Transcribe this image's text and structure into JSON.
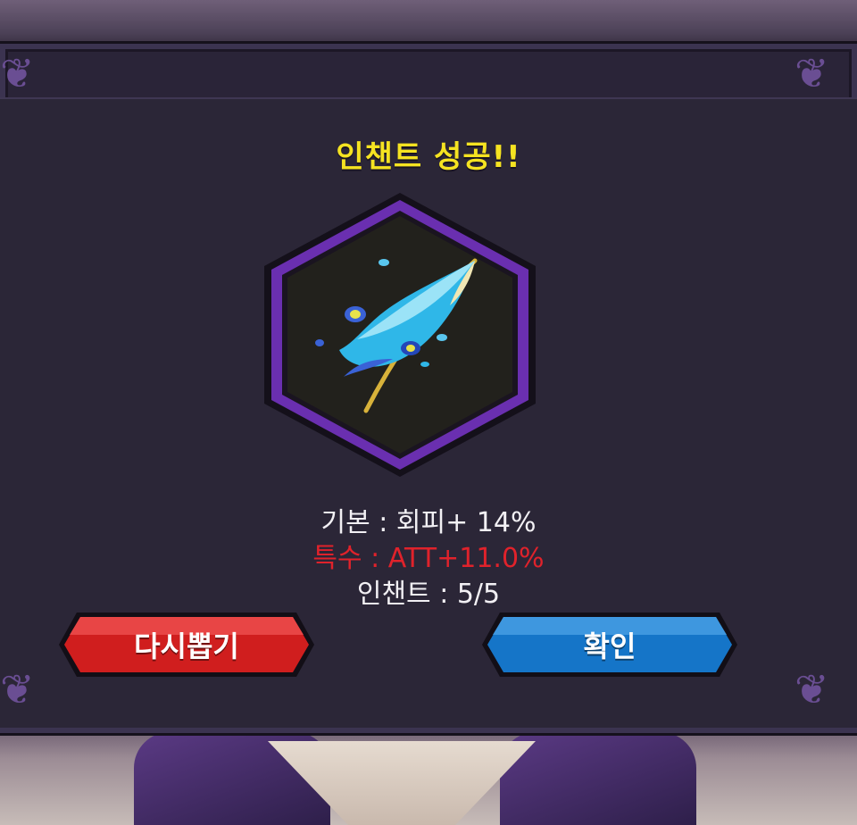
{
  "dialog": {
    "title": "인챈트 성공!!",
    "item": {
      "icon": "peacock-feather-icon",
      "frame_color": "#6a2fb0"
    },
    "stats": {
      "basic": "기본 : 회피+ 14%",
      "special": "특수 : ATT+11.0%",
      "enchant": "인챈트 : 5/5"
    },
    "buttons": {
      "redraw_label": "다시뽑기",
      "confirm_label": "확인"
    }
  },
  "colors": {
    "title": "#f5e321",
    "special_stat": "#e0222b",
    "redraw_button": "#d01e1e",
    "confirm_button": "#1575c8",
    "dialog_bg": "#2b2637"
  }
}
